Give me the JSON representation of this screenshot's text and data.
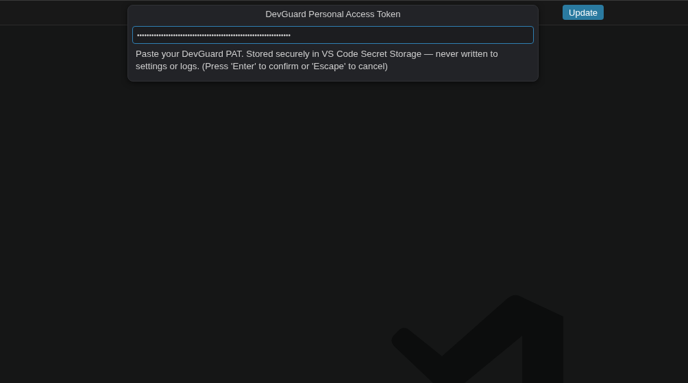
{
  "title_bar": {
    "button": "Update"
  },
  "quick_input": {
    "title": "DevGuard Personal Access Token",
    "field": {
      "value": "••••••••••••••••••••••••••••••••••••••••••••••••••••••••••••••••",
      "focused": true
    },
    "message": "Paste your DevGuard PAT. Stored securely in VS Code Secret Storage — never written to settings or logs. (Press 'Enter' to confirm or 'Escape' to cancel)"
  }
}
